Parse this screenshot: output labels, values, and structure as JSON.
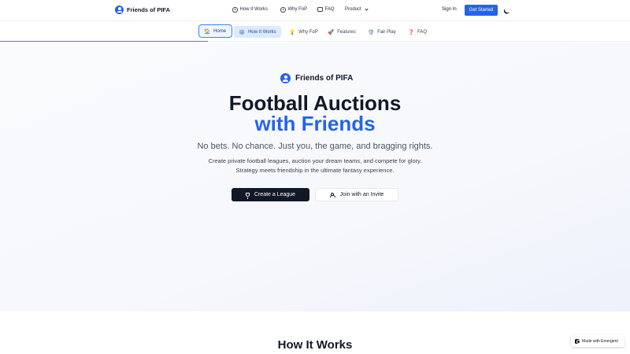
{
  "topnav": {
    "brand": "Friends of PIFA",
    "items": [
      {
        "label": "How It Works",
        "icon": "clock-icon"
      },
      {
        "label": "Why FoP",
        "icon": "info-icon"
      },
      {
        "label": "FAQ",
        "icon": "chat-icon"
      },
      {
        "label": "Product",
        "icon": "chevron-down-icon"
      }
    ],
    "signin": "Sign In",
    "get_started": "Get Started",
    "theme_icon": "moon-icon"
  },
  "section_nav": {
    "tabs": [
      {
        "label": "Home",
        "emoji": "🏠"
      },
      {
        "label": "How It Works",
        "emoji": "⚙️"
      },
      {
        "label": "Why FoP",
        "emoji": "💡"
      },
      {
        "label": "Features",
        "emoji": "🚀"
      },
      {
        "label": "Fair Play",
        "emoji": "🛡️"
      },
      {
        "label": "FAQ",
        "emoji": "❓"
      }
    ],
    "active": "Home",
    "scroll_progress": 0.33
  },
  "hero": {
    "brand": "Friends of PIFA",
    "title_line1": "Football Auctions",
    "title_line2": "with Friends",
    "tagline": "No bets. No chance. Just you, the game, and bragging rights.",
    "description": "Create private football leagues, auction your dream teams, and compete for glory. Strategy meets friendship in the ultimate fantasy experience.",
    "primary_button": "Create a League",
    "secondary_button": "Join with an Invite"
  },
  "next_section": {
    "title": "How It Works"
  },
  "badge": {
    "label": "Made with Emergent"
  },
  "colors": {
    "accent": "#2563eb",
    "dark": "#111827"
  }
}
